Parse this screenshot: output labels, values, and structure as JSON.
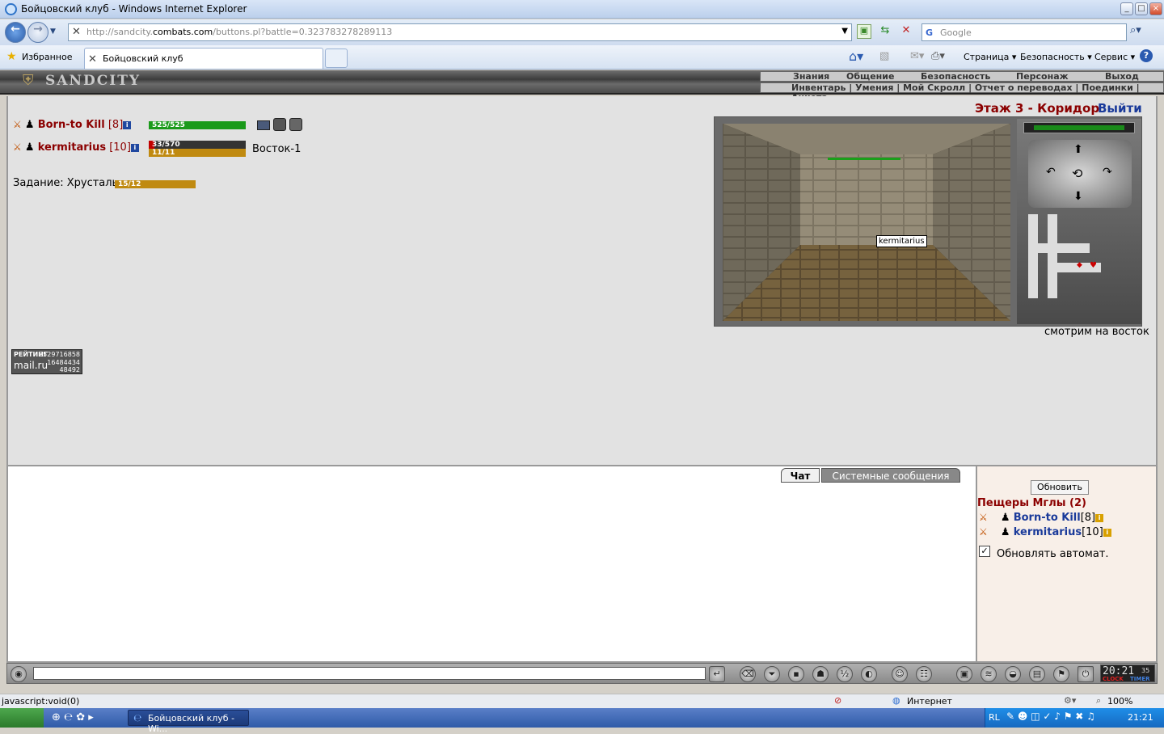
{
  "window": {
    "title": "Бойцовский клуб - Windows Internet Explorer"
  },
  "nav": {
    "url_prefix": "http://sandcity.",
    "url_domain": "combats.com",
    "url_suffix": "/buttons.pl?battle=0.323783278289113",
    "search_placeholder": "Google"
  },
  "favbar": {
    "favorites": "Избранное",
    "tab_title": "Бойцовский клуб",
    "page": "Страница ▾",
    "safety": "Безопасность ▾",
    "tools": "Сервис ▾"
  },
  "game": {
    "logo": "SANDCITY",
    "topmenu": [
      "Знания",
      "Общение",
      "Безопасность",
      "Персонаж",
      "Выход"
    ],
    "submenu": "Инвентарь | Умения | Мой Скролл | Отчет о переводах | Поединки | Анкета",
    "location": "Этаж 3 - Коридор",
    "exit": "Выйти",
    "players": [
      {
        "name": "Born-to Kill",
        "level": "[8]",
        "hp_text": "525/525",
        "hp": 1.0,
        "hp_color": "#1a9a1a"
      },
      {
        "name": "kermitarius",
        "level": "[10]",
        "hp_text": "33/570",
        "hp": 0.058,
        "hp_color": "#c00000",
        "mana_text": "11/11",
        "mana": 1.0,
        "mana_color": "#c08a10",
        "position": "Восток-1"
      }
    ],
    "quest_label": "Задание: Хрусталь",
    "quest_text": "15/12",
    "quest_fill": 1.0,
    "tooltip": "kermitarius",
    "facing": "смотрим на восток",
    "rating": {
      "label": "РЕЙТИНГ",
      "n1": "2529716858",
      "n2": "16484434",
      "n3": "48492",
      "brand": "mail.ru"
    }
  },
  "chat": {
    "tab_chat": "Чат",
    "tab_system": "Системные сообщения"
  },
  "online": {
    "refresh": "Обновить",
    "room": "Пещеры Мглы (2)",
    "users": [
      {
        "name": "Born-to Kill",
        "level": "[8]"
      },
      {
        "name": "kermitarius",
        "level": "[10]"
      }
    ],
    "auto": "Обновлять автомат."
  },
  "clock": {
    "time": "20:21",
    "sec": "35",
    "clock_label": "CLOCK",
    "timer_label": "TIMER"
  },
  "status": {
    "left": "javascript:void(0)",
    "zone": "Интернет",
    "zoom": "100%"
  },
  "taskbar": {
    "app": "Бойцовский клуб - Wi...",
    "lang": "RL",
    "time": "21:21"
  }
}
